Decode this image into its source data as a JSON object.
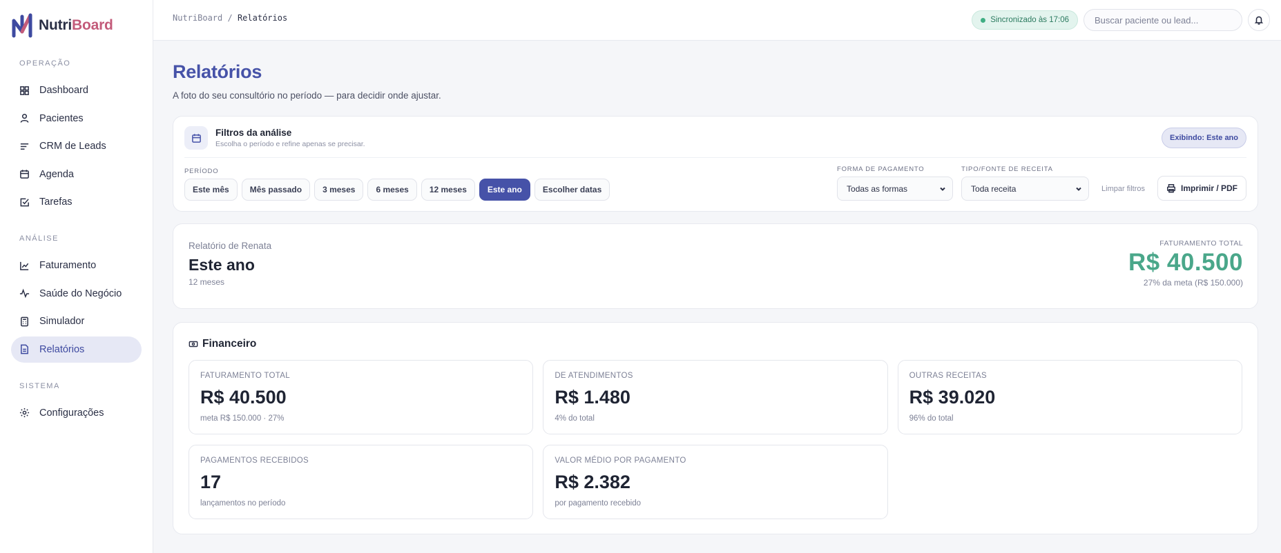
{
  "brand": {
    "name_part1": "Nutri",
    "name_part2": "Board"
  },
  "colors": {
    "primary": "#4652a8",
    "success": "#4aa78a",
    "brand_pink": "#c35b7a"
  },
  "sidebar": {
    "sections": [
      {
        "label": "OPERAÇÃO",
        "items": [
          {
            "label": "Dashboard",
            "icon": "grid-icon"
          },
          {
            "label": "Pacientes",
            "icon": "user-icon"
          },
          {
            "label": "CRM de Leads",
            "icon": "list-icon"
          },
          {
            "label": "Agenda",
            "icon": "calendar-icon"
          },
          {
            "label": "Tarefas",
            "icon": "checkbox-icon"
          }
        ]
      },
      {
        "label": "ANÁLISE",
        "items": [
          {
            "label": "Faturamento",
            "icon": "line-chart-icon"
          },
          {
            "label": "Saúde do Negócio",
            "icon": "pulse-icon"
          },
          {
            "label": "Simulador",
            "icon": "calculator-icon"
          },
          {
            "label": "Relatórios",
            "icon": "file-icon",
            "active": true
          }
        ]
      },
      {
        "label": "SISTEMA",
        "items": [
          {
            "label": "Configurações",
            "icon": "gear-icon"
          }
        ]
      }
    ]
  },
  "topbar": {
    "breadcrumb_root": "NutriBoard",
    "breadcrumb_sep": "/",
    "breadcrumb_current": "Relatórios",
    "sync_status": "Sincronizado às 17:06",
    "search_placeholder": "Buscar paciente ou lead..."
  },
  "page": {
    "title": "Relatórios",
    "subtitle": "A foto do seu consultório no período — para decidir onde ajustar."
  },
  "filters": {
    "title": "Filtros da análise",
    "hint": "Escolha o período e refine apenas se precisar.",
    "showing_badge": "Exibindo: Este ano",
    "period_label": "PERÍODO",
    "period_options": [
      "Este mês",
      "Mês passado",
      "3 meses",
      "6 meses",
      "12 meses",
      "Este ano",
      "Escolher datas"
    ],
    "period_selected": "Este ano",
    "payment_label": "FORMA DE PAGAMENTO",
    "payment_value": "Todas as formas",
    "revenue_label": "TIPO/FONTE DE RECEITA",
    "revenue_value": "Toda receita",
    "clear_label": "Limpar filtros",
    "print_label": "Imprimir / PDF"
  },
  "summary": {
    "owner": "Relatório de Renata",
    "period": "Este ano",
    "months": "12 meses",
    "total_label": "FATURAMENTO TOTAL",
    "total_value": "R$ 40.500",
    "meta_text": "27% da meta (R$ 150.000)"
  },
  "financeiro": {
    "title": "Financeiro",
    "kpis": [
      {
        "label": "FATURAMENTO TOTAL",
        "value": "R$ 40.500",
        "foot": "meta R$ 150.000 · 27%"
      },
      {
        "label": "DE ATENDIMENTOS",
        "value": "R$ 1.480",
        "foot": "4% do total"
      },
      {
        "label": "OUTRAS RECEITAS",
        "value": "R$ 39.020",
        "foot": "96% do total"
      },
      {
        "label": "PAGAMENTOS RECEBIDOS",
        "value": "17",
        "foot": "lançamentos no período"
      },
      {
        "label": "VALOR MÉDIO POR PAGAMENTO",
        "value": "R$ 2.382",
        "foot": "por pagamento recebido"
      }
    ]
  }
}
